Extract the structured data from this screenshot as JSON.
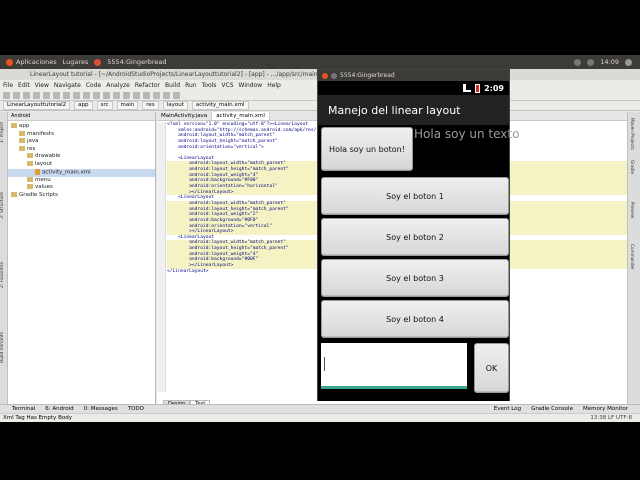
{
  "panel": {
    "apps": "Aplicaciones",
    "places": "Lugares",
    "window": "5554:Gingerbread",
    "time": "14:09"
  },
  "ide": {
    "title": "LinearLayout tutorial - [~/AndroidStudioProjects/LinearLayouttutorial2] - [app] - .../app/src/main/res/layout/activity_main.xml - Android Studio",
    "menu": [
      "File",
      "Edit",
      "View",
      "Navigate",
      "Code",
      "Analyze",
      "Refactor",
      "Build",
      "Run",
      "Tools",
      "VCS",
      "Window",
      "Help"
    ],
    "breadcrumbs": [
      "LinearLayouttutorial2",
      "app",
      "src",
      "main",
      "res",
      "layout",
      "activity_main.xml"
    ],
    "project_header": "Android",
    "tree": [
      {
        "label": "app",
        "indent": 0,
        "type": "fold"
      },
      {
        "label": "manifests",
        "indent": 1,
        "type": "fold"
      },
      {
        "label": "java",
        "indent": 1,
        "type": "fold"
      },
      {
        "label": "res",
        "indent": 1,
        "type": "fold"
      },
      {
        "label": "drawable",
        "indent": 2,
        "type": "fold"
      },
      {
        "label": "layout",
        "indent": 2,
        "type": "fold"
      },
      {
        "label": "activity_main.xml",
        "indent": 3,
        "type": "xml",
        "selected": true
      },
      {
        "label": "menu",
        "indent": 2,
        "type": "fold"
      },
      {
        "label": "values",
        "indent": 2,
        "type": "fold"
      },
      {
        "label": "Gradle Scripts",
        "indent": 0,
        "type": "fold"
      }
    ],
    "tabs": [
      {
        "label": "MainActivity.java",
        "active": false
      },
      {
        "label": "activity_main.xml",
        "active": true
      }
    ],
    "code": [
      {
        "t": "<?xml version=\"1.0\" encoding=\"utf-8\"?><LinearLayout",
        "h": false
      },
      {
        "t": "    xmlns:android=\"http://schemas.android.com/apk/res/",
        "h": false
      },
      {
        "t": "    android:layout_width=\"match_parent\"",
        "h": false
      },
      {
        "t": "    android:layout_height=\"match_parent\"",
        "h": false
      },
      {
        "t": "    android:orientation=\"vertical\">",
        "h": false
      },
      {
        "t": "",
        "h": false
      },
      {
        "t": "    <LinearLayout",
        "h": false
      },
      {
        "t": "        android:layout_width=\"match_parent\"",
        "h": true
      },
      {
        "t": "        android:layout_height=\"match_parent\"",
        "h": true
      },
      {
        "t": "        android:layout_weight=\"4\"",
        "h": true
      },
      {
        "t": "        android:background=\"#F00\"",
        "h": true
      },
      {
        "t": "        android:orientation=\"horizontal\"",
        "h": true
      },
      {
        "t": "        ></LinearLayout>",
        "h": true
      },
      {
        "t": "    <LinearLayout",
        "h": false
      },
      {
        "t": "        android:layout_width=\"match_parent\"",
        "h": true
      },
      {
        "t": "        android:layout_height=\"match_parent\"",
        "h": true
      },
      {
        "t": "        android:layout_weight=\"2\"",
        "h": true
      },
      {
        "t": "        android:background=\"#0F0\"",
        "h": true
      },
      {
        "t": "        android:orientation=\"vertical\"",
        "h": true
      },
      {
        "t": "        ></LinearLayout>",
        "h": true
      },
      {
        "t": "    <LinearLayout",
        "h": false
      },
      {
        "t": "        android:layout_width=\"match_parent\"",
        "h": true
      },
      {
        "t": "        android:layout_height=\"match_parent\"",
        "h": true
      },
      {
        "t": "        android:layout_weight=\"4\"",
        "h": true
      },
      {
        "t": "        android:background=\"#00F\"",
        "h": true
      },
      {
        "t": "        ></LinearLayout>",
        "h": true
      },
      {
        "t": "</LinearLayout>",
        "h": false
      }
    ],
    "design_tabs": [
      "Design",
      "Text"
    ],
    "right_tabs": [
      "Maven Projects",
      "Gradle",
      "Preview",
      "Commander"
    ],
    "left_tabs": [
      "1: Project",
      "2: Structure",
      "2: Favorites",
      "Build Variants"
    ],
    "bottom_left": [
      "Terminal",
      "6: Android",
      "0: Messages",
      "TODO"
    ],
    "bottom_right": [
      "Event Log",
      "Gradle Console",
      "Memory Monitor"
    ],
    "status": "Xml Tag Has Empty Body",
    "status_right": "13:38   LF   UTF-8"
  },
  "emulator": {
    "window_title": "5554:Gingerbread",
    "clock": "2:09",
    "app_title": "Manejo del linear layout",
    "hola_button": "Hola soy un boton!",
    "hola_text": "Hola soy un texto",
    "buttons": [
      "Soy el boton 1",
      "Soy el boton 2",
      "Soy el boton 3",
      "Soy el boton 4"
    ],
    "ok": "OK",
    "edit_value": ""
  },
  "colors": {
    "accent": "#39a98d",
    "highlight": "#f5f3c4",
    "xml_tag": "#000080"
  }
}
